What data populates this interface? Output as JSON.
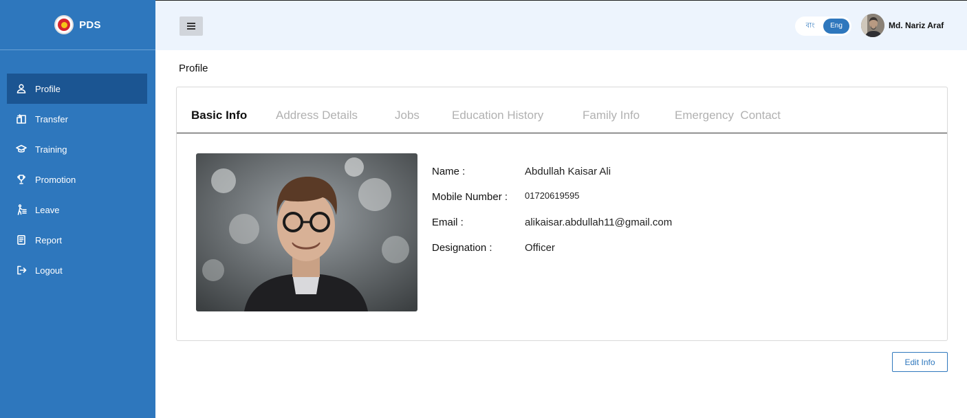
{
  "brand": {
    "name": "PDS",
    "logo_icon": "bangladesh-emblem-icon"
  },
  "sidebar": {
    "items": [
      {
        "label": "Profile",
        "icon": "user-icon",
        "active": true
      },
      {
        "label": "Transfer",
        "icon": "transfer-icon"
      },
      {
        "label": "Training",
        "icon": "graduation-cap-icon"
      },
      {
        "label": "Promotion",
        "icon": "trophy-icon"
      },
      {
        "label": "Leave",
        "icon": "walking-icon"
      },
      {
        "label": "Report",
        "icon": "document-icon"
      },
      {
        "label": "Logout",
        "icon": "logout-icon"
      }
    ]
  },
  "header": {
    "menu_icon": "hamburger-icon",
    "lang": {
      "bn": "বাং",
      "en": "Eng",
      "selected": "Eng"
    },
    "user": {
      "name": "Md. Nariz Araf"
    }
  },
  "page": {
    "title": "Profile"
  },
  "tabs": [
    {
      "label": "Basic Info",
      "active": true
    },
    {
      "label": "Address Details"
    },
    {
      "label": "Jobs"
    },
    {
      "label": "Education History"
    },
    {
      "label": "Family Info"
    },
    {
      "label": "Emergency  Contact"
    }
  ],
  "profile": {
    "fields": [
      {
        "label": "Name :",
        "value": "Abdullah Kaisar Ali"
      },
      {
        "label": "Mobile Number :",
        "value": "01720619595"
      },
      {
        "label": "Email :",
        "value": "alikaisar.abdullah11@gmail.com"
      },
      {
        "label": "Designation :",
        "value": "Officer"
      }
    ]
  },
  "actions": {
    "edit_label": "Edit Info"
  },
  "colors": {
    "primary": "#2e77bd",
    "active_nav": "#1b5592",
    "topbar": "#edf4fd"
  }
}
